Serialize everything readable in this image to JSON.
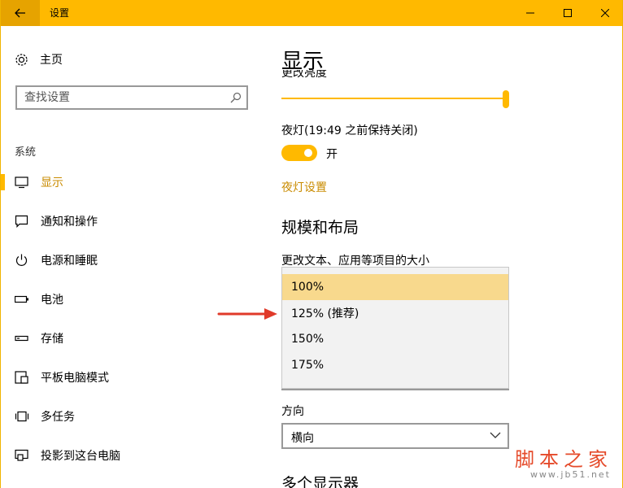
{
  "window": {
    "title": "设置"
  },
  "sidebar": {
    "home_label": "主页",
    "search_placeholder": "查找设置",
    "section_label": "系统",
    "items": [
      {
        "label": "显示",
        "icon": "monitor-icon",
        "active": true
      },
      {
        "label": "通知和操作",
        "icon": "chat-icon"
      },
      {
        "label": "电源和睡眠",
        "icon": "power-icon"
      },
      {
        "label": "电池",
        "icon": "battery-icon"
      },
      {
        "label": "存储",
        "icon": "storage-icon"
      },
      {
        "label": "平板电脑模式",
        "icon": "tablet-icon"
      },
      {
        "label": "多任务",
        "icon": "multitask-icon"
      },
      {
        "label": "投影到这台电脑",
        "icon": "project-icon"
      }
    ]
  },
  "main": {
    "title": "显示",
    "brightness_label_cut": "更改亮度",
    "brightness_value": 100,
    "night_light_label": "夜灯(19:49 之前保持关闭)",
    "night_toggle_text": "开",
    "night_settings_link": "夜灯设置",
    "scale_section_title": "规模和布局",
    "scale_label": "更改文本、应用等项目的大小",
    "scale_options": [
      "100%",
      "125% (推荐)",
      "150%",
      "175%"
    ],
    "scale_selected_index": 0,
    "orientation_label": "方向",
    "orientation_value": "横向",
    "next_section_cut": "多个显示器"
  },
  "watermark": {
    "main": "脚本之家",
    "sub": "www.jb51.net"
  },
  "colors": {
    "accent": "#ffb900",
    "accent_dark": "#e6a300",
    "link": "#c98b00",
    "selected": "#f8d98d",
    "arrow": "#e03a2a"
  }
}
